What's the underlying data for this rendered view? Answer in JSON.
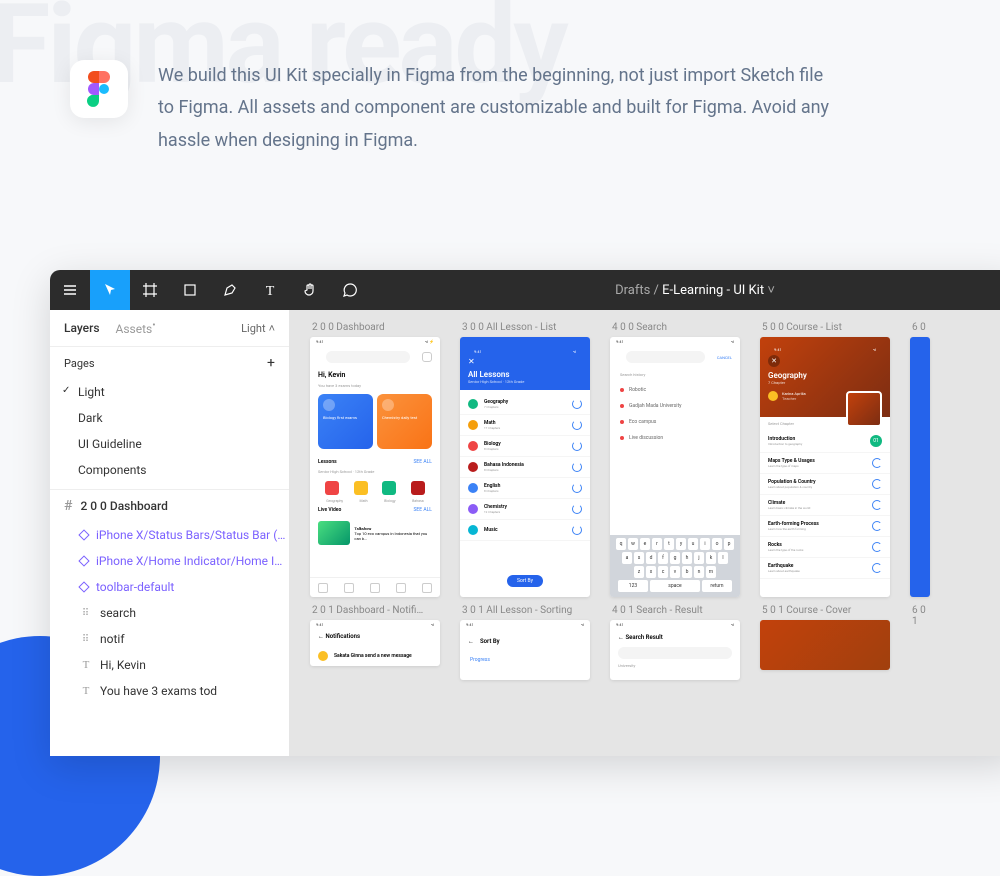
{
  "bg_text": "Figma ready",
  "hero_text": "We build this UI Kit specially in Figma from the beginning, not just import Sketch file to Figma. All assets and component are customizable and built for Figma. Avoid any hassle when designing in Figma.",
  "figma": {
    "doc_path_prefix": "Drafts / ",
    "doc_name": "E-Learning - UI Kit",
    "sidebar": {
      "tabs": {
        "layers": "Layers",
        "assets": "Assets"
      },
      "light_selector": "Light",
      "pages_label": "Pages",
      "pages": [
        "Light",
        "Dark",
        "UI Guideline",
        "Components"
      ],
      "frame_head": "2 0 0 Dashboard",
      "layers": [
        {
          "type": "comp",
          "name": "iPhone X/Status Bars/Status Bar (…"
        },
        {
          "type": "comp",
          "name": "iPhone X/Home Indicator/Home I…"
        },
        {
          "type": "comp",
          "name": "toolbar-default"
        },
        {
          "type": "group",
          "name": "search"
        },
        {
          "type": "group",
          "name": "notif"
        },
        {
          "type": "text",
          "name": "Hi, Kevin"
        },
        {
          "type": "text",
          "name": "You have 3 exams tod"
        }
      ]
    },
    "artboards_row1": [
      "2 0 0 Dashboard",
      "3 0 0 All Lesson - List",
      "4 0 0 Search",
      "5 0 0 Course - List",
      "6 0"
    ],
    "artboards_row2": [
      "2 0 1 Dashboard - Notifi…",
      "3 0 1 All Lesson - Sorting",
      "4 0 1 Search - Result",
      "5 0 1 Course - Cover",
      "6 0 1"
    ],
    "dashboard": {
      "time": "9:41",
      "greet": "Hi, Kevin",
      "sub": "You have 3 exams today",
      "card1": "Biology first exams",
      "card2": "Chemistry daily test",
      "lessons": "Lessons",
      "seeall": "SEE ALL",
      "cats": [
        "Geography",
        "Math",
        "Biology",
        "Bahasa"
      ],
      "live": "Live Video",
      "live_title": "Top 10 eco campus in Indonesia that you can b…"
    },
    "all_lessons": {
      "title": "All Lessons",
      "sub": "Senior High School · 12th Grade",
      "items": [
        {
          "name": "Geography",
          "sub": "7 Chapters",
          "color": "#10b981"
        },
        {
          "name": "Math",
          "sub": "17 Chapters",
          "color": "#f59e0b"
        },
        {
          "name": "Biology",
          "sub": "8 Chapters",
          "color": "#ef4444"
        },
        {
          "name": "Bahasa Indonesia",
          "sub": "8 Chapters",
          "color": "#b91c1c"
        },
        {
          "name": "English",
          "sub": "8 Chapters",
          "color": "#3b82f6"
        },
        {
          "name": "Chemistry",
          "sub": "12 Chapters",
          "color": "#8b5cf6"
        },
        {
          "name": "Music",
          "sub": "",
          "color": "#06b6d4"
        }
      ],
      "sort_btn": "Sort By"
    },
    "search": {
      "cancel": "CANCEL",
      "history": "Search history",
      "items": [
        "Robotic",
        "Gadjah Mada University",
        "Eco campus",
        "Live discussion"
      ],
      "keys_r1": [
        "q",
        "w",
        "e",
        "r",
        "t",
        "y",
        "u",
        "i",
        "o",
        "p"
      ],
      "keys_r2": [
        "a",
        "s",
        "d",
        "f",
        "g",
        "h",
        "j",
        "k",
        "l"
      ],
      "keys_r3": [
        "z",
        "x",
        "c",
        "v",
        "b",
        "n",
        "m"
      ],
      "keys_r4": [
        "123",
        "space",
        "return"
      ]
    },
    "course": {
      "title": "Geography",
      "sub": "7 Chapter",
      "teacher": "Karina Aprilia",
      "role": "Teacher",
      "select": "Select Chapter",
      "items": [
        {
          "t": "Introduction",
          "s": "Introduction to geography",
          "b": "01"
        },
        {
          "t": "Maps Type & Usages",
          "s": "Learn the type of maps"
        },
        {
          "t": "Population & Country",
          "s": "Learn about population & country"
        },
        {
          "t": "Climate",
          "s": "Learn basic climate in the world"
        },
        {
          "t": "Earth-forming Process",
          "s": "Learn how the earth forming"
        },
        {
          "t": "Rocks",
          "s": "Learn the type of the rocks"
        },
        {
          "t": "Earthquake",
          "s": "Learn about earthquake"
        }
      ]
    },
    "sortby": {
      "title": "Sort By",
      "progress": "Progress"
    },
    "notif": {
      "title": "Notifications",
      "msg": "Sakata Ginna send a new message"
    },
    "search_result": {
      "title": "Search Result",
      "university": "University"
    }
  }
}
